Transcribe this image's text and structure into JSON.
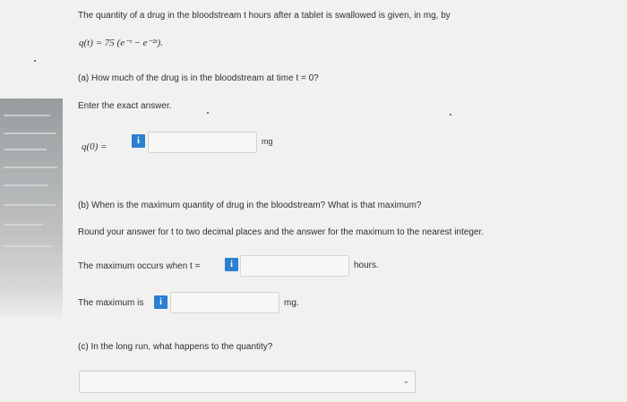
{
  "question": {
    "intro": "The quantity of a drug in the bloodstream t hours after a tablet is swallowed is given, in mg, by",
    "formula": "q(t) = 75 (e⁻ᵗ − e⁻²ᵗ)."
  },
  "part_a": {
    "prompt": "(a) How much of the drug is in the bloodstream at time t = 0?",
    "instruction": "Enter the exact answer.",
    "input_label": "q(0) =",
    "input_value": "",
    "unit": "mg",
    "info_icon": "i"
  },
  "part_b": {
    "prompt": "(b) When is the maximum quantity of drug in the bloodstream? What is that maximum?",
    "instruction": "Round your answer for t to two decimal places and the answer for the maximum to the nearest integer.",
    "time_label": "The maximum occurs when t =",
    "time_value": "",
    "time_unit": "hours.",
    "max_label": "The maximum is",
    "max_value": "",
    "max_unit": "mg.",
    "info_icon": "i"
  },
  "part_c": {
    "prompt": "(c) In the long run, what happens to the quantity?",
    "selected_option": ""
  },
  "icons": {
    "info": "info-icon",
    "dropdown": "chevron-down-icon"
  },
  "colors": {
    "info_button": "#2d7fd0",
    "background": "#f1f2f0"
  }
}
